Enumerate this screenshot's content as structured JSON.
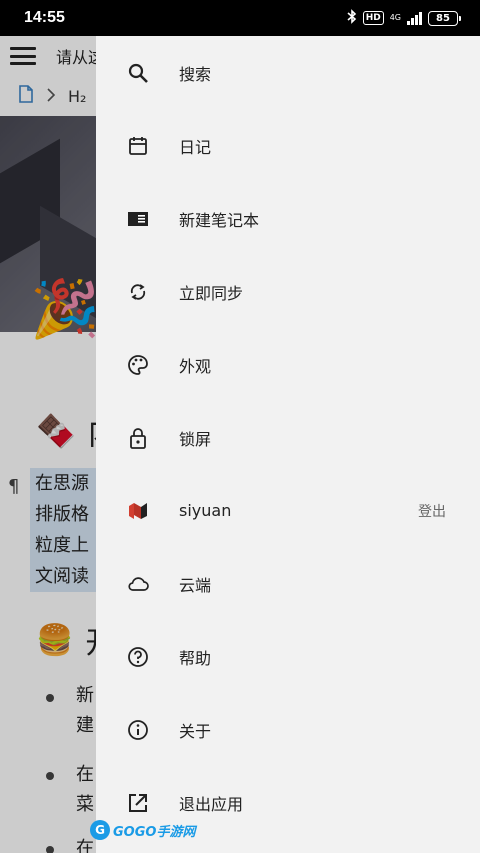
{
  "status_bar": {
    "time": "14:55",
    "hd": "HD",
    "network": "4G",
    "battery": "85"
  },
  "editor": {
    "toolbar_title": "请从这",
    "breadcrumb_doc": "H₂",
    "heading1": "内",
    "paragraph_lines": [
      "在思源",
      "排版格",
      "粒度上",
      "文阅读"
    ],
    "heading2": "开",
    "bullets": [
      {
        "line1": "新",
        "line2": "建"
      },
      {
        "line1": "在",
        "line2": "菜"
      },
      {
        "line1": "在",
        "line2": ""
      }
    ]
  },
  "drawer": {
    "items": [
      {
        "label": "搜索",
        "icon": "search-icon"
      },
      {
        "label": "日记",
        "icon": "calendar-icon"
      },
      {
        "label": "新建笔记本",
        "icon": "notebook-icon"
      },
      {
        "label": "立即同步",
        "icon": "sync-icon"
      },
      {
        "label": "外观",
        "icon": "palette-icon"
      },
      {
        "label": "锁屏",
        "icon": "lock-icon"
      },
      {
        "label": "siyuan",
        "icon": "siyuan-logo-icon",
        "aux": "登出"
      },
      {
        "label": "云端",
        "icon": "cloud-icon"
      },
      {
        "label": "帮助",
        "icon": "help-icon"
      },
      {
        "label": "关于",
        "icon": "info-icon"
      },
      {
        "label": "退出应用",
        "icon": "exit-icon"
      }
    ]
  },
  "watermark": {
    "text": "GOGO手游网"
  }
}
